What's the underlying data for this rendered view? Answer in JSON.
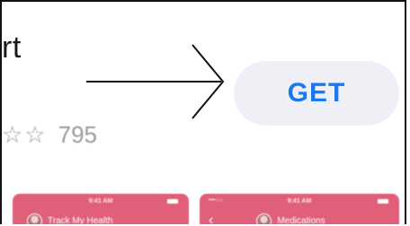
{
  "app": {
    "title_fragment": "rt",
    "rating": {
      "stars_visible": "☆☆",
      "count": "795"
    }
  },
  "get_button": {
    "label": "GET",
    "color": "#1a78f0"
  },
  "screenshots": [
    {
      "time": "9:41 AM",
      "title": "Track My Health"
    },
    {
      "time": "9:41 AM",
      "signal": "•••○○ ",
      "back": "‹",
      "title": "Medications"
    }
  ],
  "colors": {
    "screenshot_bg": "#e0607a",
    "button_bg": "#eef0f5"
  }
}
